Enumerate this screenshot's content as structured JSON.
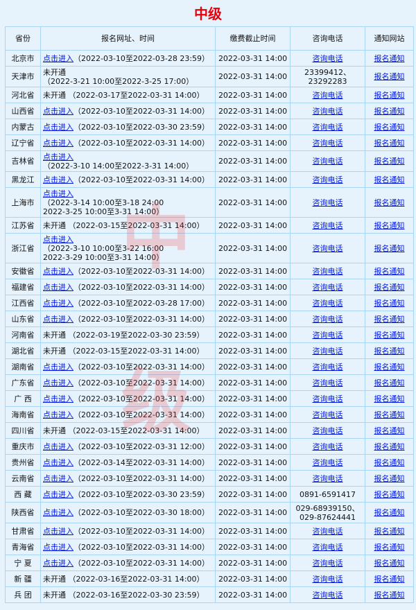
{
  "title": "中级",
  "watermark": [
    "中",
    "级"
  ],
  "headers": [
    "省份",
    "报名网址、时间",
    "缴费截止时间",
    "咨询电话",
    "通知网站"
  ],
  "rows": [
    {
      "province": "北京市",
      "reg_lines": [
        {
          "link": "点击进入",
          "text": "（2022-03-10至2022-03-28 23:59）"
        }
      ],
      "deadline": "2022-03-31 14:00",
      "phone": "咨询电话",
      "phone_link": true,
      "notice": "报名通知"
    },
    {
      "province": "天津市",
      "reg_lines": [
        {
          "text": "未开通"
        },
        {
          "text": "（2022-3-21 10:00至2022-3-25 17:00）"
        }
      ],
      "deadline": "2022-03-31 14:00",
      "phone": "23399412、23292283",
      "phone_lines": [
        "23399412、",
        "23292283"
      ],
      "phone_link": false,
      "notice": "报名通知"
    },
    {
      "province": "河北省",
      "reg_lines": [
        {
          "text": "未开通 （2022-03-17至2022-03-31 14:00）"
        }
      ],
      "deadline": "2022-03-31 14:00",
      "phone": "咨询电话",
      "phone_link": true,
      "notice": "报名通知"
    },
    {
      "province": "山西省",
      "reg_lines": [
        {
          "link": "点击进入",
          "text": "（2022-03-10至2022-03-31 14:00）"
        }
      ],
      "deadline": "2022-03-31 14:00",
      "phone": "咨询电话",
      "phone_link": true,
      "notice": "报名通知"
    },
    {
      "province": "内蒙古",
      "reg_lines": [
        {
          "link": "点击进入",
          "text": "（2022-03-10至2022-03-30 23:59）"
        }
      ],
      "deadline": "2022-03-31 14:00",
      "phone": "咨询电话",
      "phone_link": true,
      "notice": "报名通知"
    },
    {
      "province": "辽宁省",
      "reg_lines": [
        {
          "link": "点击进入",
          "text": "（2022-03-10至2022-03-31 14:00）"
        }
      ],
      "deadline": "2022-03-31 14:00",
      "phone": "咨询电话",
      "phone_link": true,
      "notice": "报名通知"
    },
    {
      "province": "吉林省",
      "reg_lines": [
        {
          "link": "点击进入"
        },
        {
          "text": "（2022-3-10 14:00至2022-3-31 14:00）"
        }
      ],
      "deadline": "2022-03-31 14:00",
      "phone": "咨询电话",
      "phone_link": true,
      "notice": "报名通知"
    },
    {
      "province": "黑龙江",
      "reg_lines": [
        {
          "link": "点击进入",
          "text": "（2022-03-10至2022-03-31 14:00）"
        }
      ],
      "deadline": "2022-03-31 14:00",
      "phone": "咨询电话",
      "phone_link": true,
      "notice": "报名通知"
    },
    {
      "province": "上海市",
      "reg_lines": [
        {
          "link": "点击进入"
        },
        {
          "text": "（2022-3-14 10:00至3-18 24:00"
        },
        {
          "text": "2022-3-25 10:00至3-31 14:00）"
        }
      ],
      "deadline": "2022-03-31 14:00",
      "phone": "咨询电话",
      "phone_link": true,
      "notice": "报名通知"
    },
    {
      "province": "江苏省",
      "reg_lines": [
        {
          "text": "未开通 （2022-03-15至2022-03-31 14:00）"
        }
      ],
      "deadline": "2022-03-31 14:00",
      "phone": "咨询电话",
      "phone_link": true,
      "notice": "报名通知"
    },
    {
      "province": "浙江省",
      "reg_lines": [
        {
          "link": "点击进入"
        },
        {
          "text": "（2022-3-10 10:00至3-22 16:00"
        },
        {
          "text": "2022-3-29 10:00至3-31 14:00）"
        }
      ],
      "deadline": "2022-03-31 14:00",
      "phone": "咨询电话",
      "phone_link": true,
      "notice": "报名通知"
    },
    {
      "province": "安徽省",
      "reg_lines": [
        {
          "link": "点击进入",
          "text": "（2022-03-10至2022-03-31 14:00）"
        }
      ],
      "deadline": "2022-03-31 14:00",
      "phone": "咨询电话",
      "phone_link": true,
      "notice": "报名通知"
    },
    {
      "province": "福建省",
      "reg_lines": [
        {
          "link": "点击进入",
          "text": "（2022-03-10至2022-03-31 14:00）"
        }
      ],
      "deadline": "2022-03-31 14:00",
      "phone": "咨询电话",
      "phone_link": true,
      "notice": "报名通知"
    },
    {
      "province": "江西省",
      "reg_lines": [
        {
          "link": "点击进入",
          "text": "（2022-03-10至2022-03-28 17:00）"
        }
      ],
      "deadline": "2022-03-31 14:00",
      "phone": "咨询电话",
      "phone_link": true,
      "notice": "报名通知"
    },
    {
      "province": "山东省",
      "reg_lines": [
        {
          "link": "点击进入",
          "text": "（2022-03-10至2022-03-31 14:00）"
        }
      ],
      "deadline": "2022-03-31 14:00",
      "phone": "咨询电话",
      "phone_link": true,
      "notice": "报名通知"
    },
    {
      "province": "河南省",
      "reg_lines": [
        {
          "text": "未开通 （2022-03-19至2022-03-30 23:59）"
        }
      ],
      "deadline": "2022-03-31 14:00",
      "phone": "咨询电话",
      "phone_link": true,
      "notice": "报名通知"
    },
    {
      "province": "湖北省",
      "reg_lines": [
        {
          "text": "未开通 （2022-03-15至2022-03-31 14:00）"
        }
      ],
      "deadline": "2022-03-31 14:00",
      "phone": "咨询电话",
      "phone_link": true,
      "notice": "报名通知"
    },
    {
      "province": "湖南省",
      "reg_lines": [
        {
          "link": "点击进入",
          "text": "（2022-03-10至2022-03-31 14:00）"
        }
      ],
      "deadline": "2022-03-31 14:00",
      "phone": "咨询电话",
      "phone_link": true,
      "notice": "报名通知"
    },
    {
      "province": "广东省",
      "reg_lines": [
        {
          "link": "点击进入",
          "text": "（2022-03-10至2022-03-31 14:00）"
        }
      ],
      "deadline": "2022-03-31 14:00",
      "phone": "咨询电话",
      "phone_link": true,
      "notice": "报名通知"
    },
    {
      "province": "广 西",
      "reg_lines": [
        {
          "link": "点击进入",
          "text": "（2022-03-10至2022-03-31 14:00）"
        }
      ],
      "deadline": "2022-03-31 14:00",
      "phone": "咨询电话",
      "phone_link": true,
      "notice": "报名通知"
    },
    {
      "province": "海南省",
      "reg_lines": [
        {
          "link": "点击进入",
          "text": "（2022-03-10至2022-03-31 14:00）"
        }
      ],
      "deadline": "2022-03-31 14:00",
      "phone": "咨询电话",
      "phone_link": true,
      "notice": "报名通知"
    },
    {
      "province": "四川省",
      "reg_lines": [
        {
          "text": "未开通 （2022-03-15至2022-03-31 14:00）"
        }
      ],
      "deadline": "2022-03-31 14:00",
      "phone": "咨询电话",
      "phone_link": true,
      "notice": "报名通知"
    },
    {
      "province": "重庆市",
      "reg_lines": [
        {
          "link": "点击进入",
          "text": "（2022-03-10至2022-03-31 12:00）"
        }
      ],
      "deadline": "2022-03-31 14:00",
      "phone": "咨询电话",
      "phone_link": true,
      "notice": "报名通知"
    },
    {
      "province": "贵州省",
      "reg_lines": [
        {
          "link": "点击进入",
          "text": "（2022-03-14至2022-03-31 14:00）"
        }
      ],
      "deadline": "2022-03-31 14:00",
      "phone": "咨询电话",
      "phone_link": true,
      "notice": "报名通知"
    },
    {
      "province": "云南省",
      "reg_lines": [
        {
          "link": "点击进入",
          "text": "（2022-03-10至2022-03-31 14:00）"
        }
      ],
      "deadline": "2022-03-31 14:00",
      "phone": "咨询电话",
      "phone_link": true,
      "notice": "报名通知"
    },
    {
      "province": "西 藏",
      "reg_lines": [
        {
          "link": "点击进入",
          "text": "（2022-03-10至2022-03-30 23:59）"
        }
      ],
      "deadline": "2022-03-31 14:00",
      "phone": "0891-6591417",
      "phone_link": false,
      "notice": "报名通知"
    },
    {
      "province": "陕西省",
      "reg_lines": [
        {
          "link": "点击进入",
          "text": "（2022-03-10至2022-03-30 18:00）"
        }
      ],
      "deadline": "2022-03-31 14:00",
      "phone": "029-68939150、029-87624441",
      "phone_lines": [
        "029-68939150、",
        "029-87624441"
      ],
      "phone_link": false,
      "notice": "报名通知"
    },
    {
      "province": "甘肃省",
      "reg_lines": [
        {
          "link": "点击进入",
          "text": "（2022-03-10至2022-03-31 14:00）"
        }
      ],
      "deadline": "2022-03-31 14:00",
      "phone": "咨询电话",
      "phone_link": true,
      "notice": "报名通知"
    },
    {
      "province": "青海省",
      "reg_lines": [
        {
          "link": "点击进入",
          "text": "（2022-03-10至2022-03-31 14:00）"
        }
      ],
      "deadline": "2022-03-31 14:00",
      "phone": "咨询电话",
      "phone_link": true,
      "notice": "报名通知"
    },
    {
      "province": "宁 夏",
      "reg_lines": [
        {
          "link": "点击进入",
          "text": "（2022-03-10至2022-03-31 14:00）"
        }
      ],
      "deadline": "2022-03-31 14:00",
      "phone": "咨询电话",
      "phone_link": true,
      "notice": "报名通知"
    },
    {
      "province": "新 疆",
      "reg_lines": [
        {
          "text": "未开通 （2022-03-16至2022-03-31 14:00）"
        }
      ],
      "deadline": "2022-03-31 14:00",
      "phone": "咨询电话",
      "phone_link": true,
      "notice": "报名通知"
    },
    {
      "province": "兵 团",
      "reg_lines": [
        {
          "text": "未开通 （2022-03-16至2022-03-30 23:59）"
        }
      ],
      "deadline": "2022-03-31 14:00",
      "phone": "咨询电话",
      "phone_link": true,
      "notice": "报名通知"
    }
  ]
}
